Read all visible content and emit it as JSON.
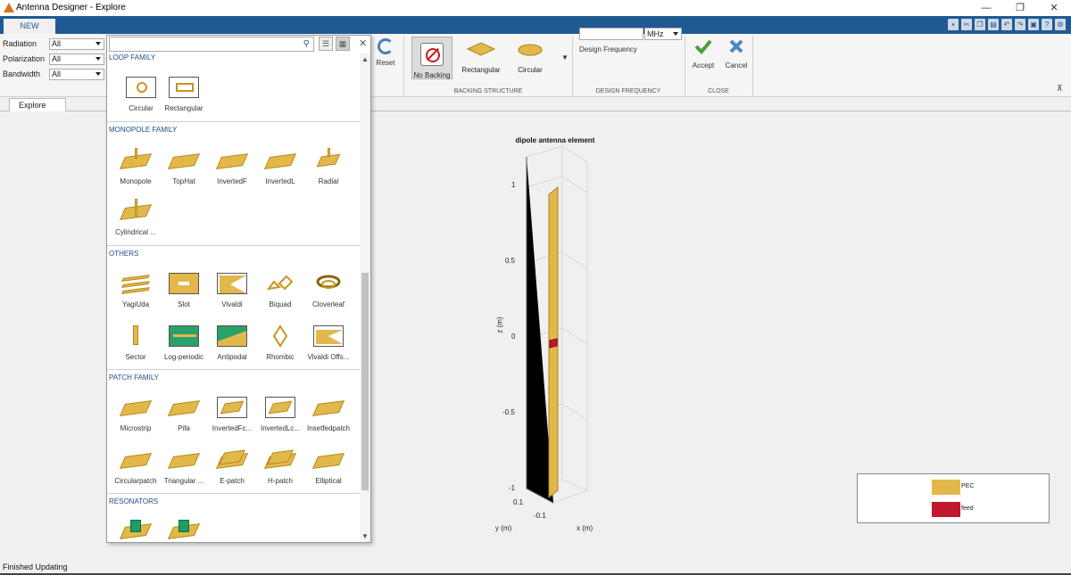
{
  "window": {
    "title": "Antenna Designer - Explore",
    "min": "—",
    "restore": "❐",
    "close": "✕"
  },
  "tabs": {
    "main": "NEW",
    "document": "Explore"
  },
  "filters": [
    {
      "label": "Radiation",
      "value": "All"
    },
    {
      "label": "Polarization",
      "value": "All"
    },
    {
      "label": "Bandwidth",
      "value": "All"
    }
  ],
  "toolstrip": {
    "reset": "Reset",
    "backing_options": [
      "No Backing",
      "Rectangular",
      "Circular"
    ],
    "backing_section": "BACKING STRUCTURE",
    "design_frequency_label": "Design Frequency",
    "design_frequency_value": "",
    "frequency_unit": "MHz",
    "design_frequency_section": "DESIGN FREQUENCY",
    "accept": "Accept",
    "cancel": "Cancel",
    "close_section": "CLOSE"
  },
  "gallery": {
    "search_placeholder": "",
    "categories": [
      {
        "name": "LOOP FAMILY",
        "items": [
          "Circular",
          "Rectangular"
        ]
      },
      {
        "name": "MONOPOLE FAMILY",
        "items": [
          "Monopole",
          "TopHat",
          "InvertedF",
          "InvertedL",
          "Radial",
          "Cylindrical ..."
        ]
      },
      {
        "name": "OTHERS",
        "items": [
          "YagiUda",
          "Slot",
          "Vivaldi",
          "Biquad",
          "Cloverleaf",
          "Sector",
          "Log-periodic",
          "Antipodal",
          "Rhombic",
          "Vivaldi Offs..."
        ]
      },
      {
        "name": "PATCH FAMILY",
        "items": [
          "Microstrip",
          "Pifa",
          "InvertedFc...",
          "InvertedLc...",
          "Insetfedpatch",
          "Circularpatch",
          "Triangular ...",
          "E-patch",
          "H-patch",
          "Elliptical"
        ]
      },
      {
        "name": "RESONATORS",
        "items": [
          "",
          ""
        ]
      }
    ]
  },
  "plot": {
    "title": "dipole antenna element",
    "zlabel": "z (m)",
    "xlabel": "x (m)",
    "ylabel": "y (m)",
    "z_ticks": [
      "1",
      "0.5",
      "0",
      "-0.5",
      "-1"
    ],
    "y_tick": "0.1",
    "x_tick": "-0.1",
    "legend": [
      {
        "label": "PEC",
        "color": "#e3b84a"
      },
      {
        "label": "feed",
        "color": "#c0182e"
      }
    ]
  },
  "status": "Finished Updating"
}
